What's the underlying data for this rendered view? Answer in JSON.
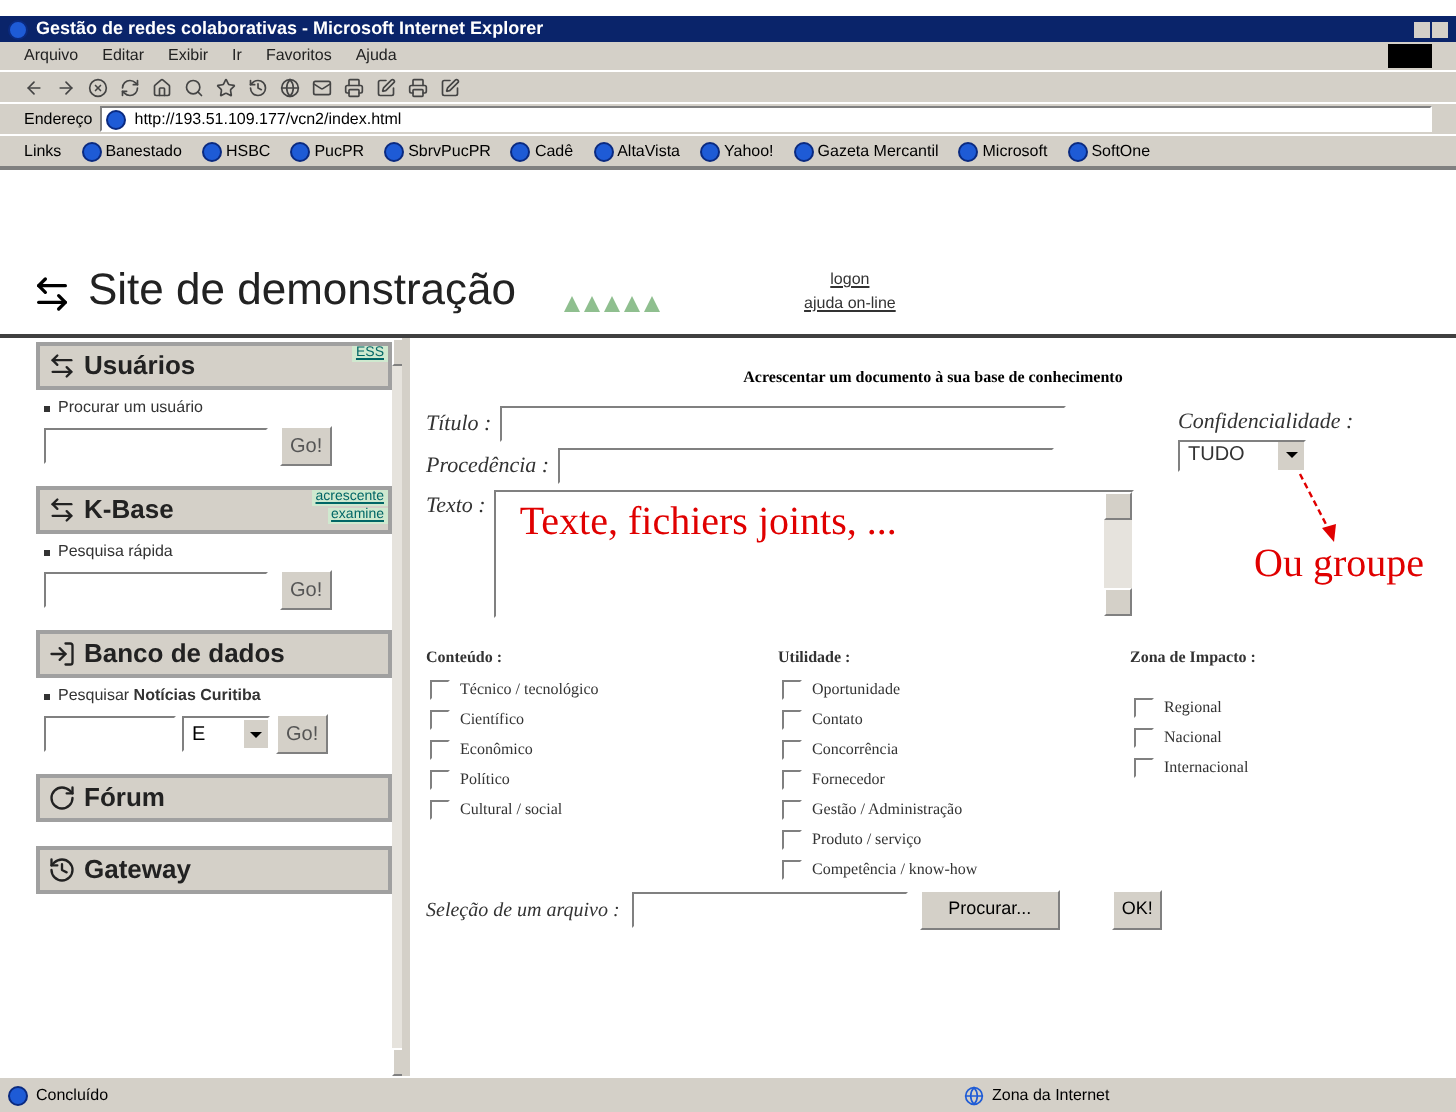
{
  "window": {
    "title": "Gestão de redes colaborativas - Microsoft Internet Explorer"
  },
  "menu": [
    "Arquivo",
    "Editar",
    "Exibir",
    "Ir",
    "Favoritos",
    "Ajuda"
  ],
  "address": {
    "label": "Endereço",
    "value": "http://193.51.109.177/vcn2/index.html"
  },
  "links": {
    "label": "Links",
    "items": [
      "Banestado",
      "HSBC",
      "PucPR",
      "SbrvPucPR",
      "Cadê",
      "AltaVista",
      "Yahoo!",
      "Gazeta Mercantil",
      "Microsoft",
      "SoftOne"
    ]
  },
  "header": {
    "title": "Site de demonstração",
    "logon": "logon",
    "help": "ajuda on-line"
  },
  "sidebar": [
    {
      "kind": "search",
      "title": "Usuários",
      "badge": "ESS",
      "hint": "Procurar um usuário",
      "button": "Go!"
    },
    {
      "kind": "search",
      "title": "K-Base",
      "badge": "acrescente",
      "badge2": "examine",
      "hint": "Pesquisa rápida",
      "button": "Go!"
    },
    {
      "kind": "news",
      "title": "Banco de dados",
      "hint": "Pesquisar ",
      "hint_bold": "Notícias Curitiba",
      "select": "E",
      "button": "Go!"
    },
    {
      "kind": "plain",
      "title": "Fórum"
    },
    {
      "kind": "plain",
      "title": "Gateway"
    }
  ],
  "form": {
    "heading": "Acrescentar um documento à sua base de conhecimento",
    "title_label": "Título :",
    "origin_label": "Procedência :",
    "text_label": "Texto :",
    "text_value": "Texte, fichiers joints, ...",
    "confidentiality_label": "Confidencialidade :",
    "confidentiality_value": "TUDO",
    "annotation": "Ou groupe",
    "groups": [
      {
        "title": "Conteúdo :",
        "items": [
          {
            "label": "Técnico / tecnológico",
            "checked": false
          },
          {
            "label": "Científico",
            "checked": false
          },
          {
            "label": "Econômico",
            "checked": false
          },
          {
            "label": "Político",
            "checked": false
          },
          {
            "label": "Cultural / social",
            "checked": false
          }
        ]
      },
      {
        "title": "Utilidade :",
        "items": [
          {
            "label": "Oportunidade",
            "checked": false
          },
          {
            "label": "Contato",
            "checked": false
          },
          {
            "label": "Concorrência",
            "checked": false
          },
          {
            "label": "Fornecedor",
            "checked": false
          },
          {
            "label": "Gestão / Administração",
            "checked": false
          },
          {
            "label": "Produto / serviço",
            "checked": false
          },
          {
            "label": "Competência / know-how",
            "checked": false
          }
        ]
      },
      {
        "title": "Zona de Impacto :",
        "items": [
          {
            "label": "Regional",
            "checked": false
          },
          {
            "label": "Nacional",
            "checked": false
          },
          {
            "label": "Internacional",
            "checked": false
          }
        ]
      }
    ],
    "file_label": "Seleção de um arquivo :",
    "browse": "Procurar...",
    "ok": "OK!"
  },
  "status_bar": {
    "text": "Concluído",
    "zone": "Zona da Internet"
  }
}
